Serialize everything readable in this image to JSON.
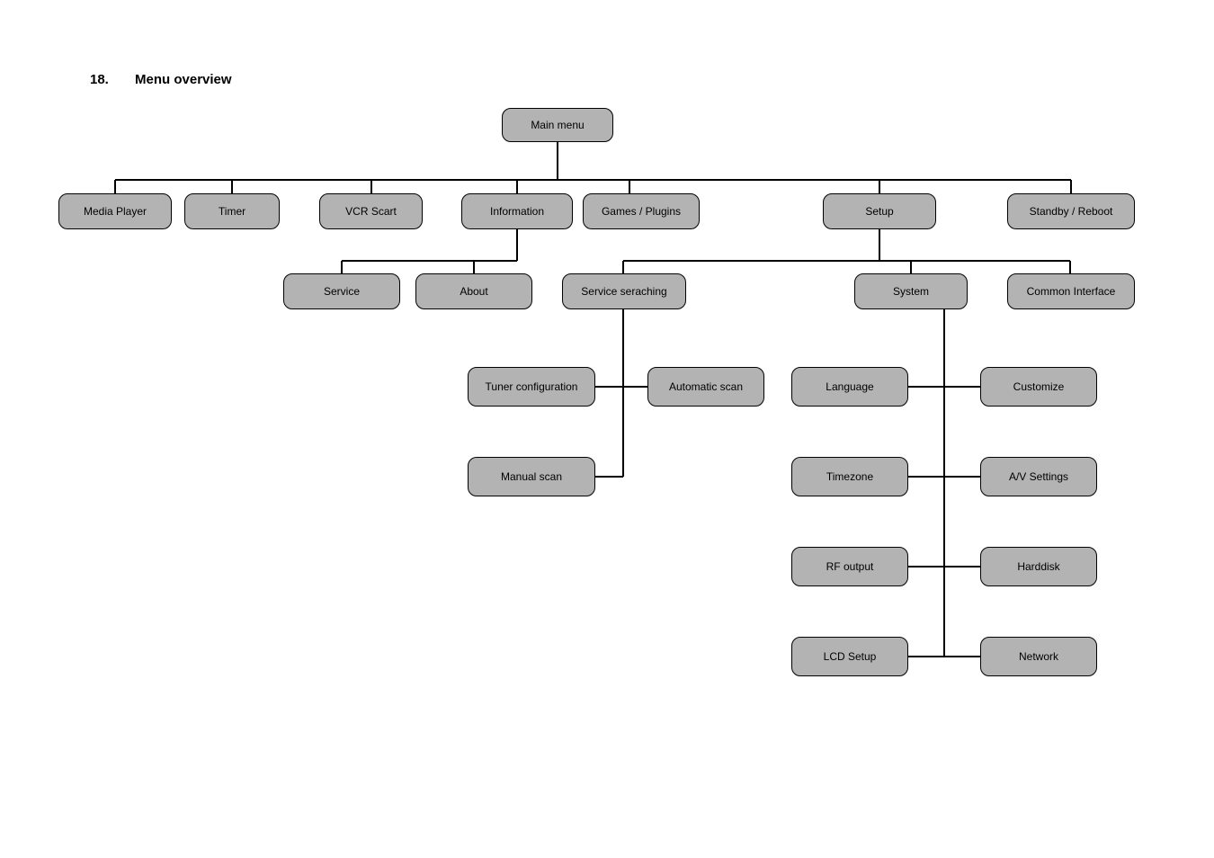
{
  "heading": {
    "number": "18.",
    "title": "Menu overview"
  },
  "root": {
    "label": "Main  menu"
  },
  "level1": {
    "media_player": "Media Player",
    "timer": "Timer",
    "vcr_scart": "VCR Scart",
    "information": "Information",
    "games_plugins": "Games / Plugins",
    "setup": "Setup",
    "standby_reboot": "Standby / Reboot"
  },
  "information": {
    "service": "Service",
    "about": "About"
  },
  "setup": {
    "service_searching": "Service seraching",
    "system": "System",
    "common_interface": "Common Interface"
  },
  "service_searching": {
    "tuner_configuration": "Tuner configuration",
    "automatic_scan": "Automatic scan",
    "manual_scan": "Manual scan"
  },
  "system": {
    "language": "Language",
    "customize": "Customize",
    "timezone": "Timezone",
    "av_settings": "A/V Settings",
    "rf_output": "RF output",
    "harddisk": "Harddisk",
    "lcd_setup": "LCD Setup",
    "network": "Network"
  }
}
